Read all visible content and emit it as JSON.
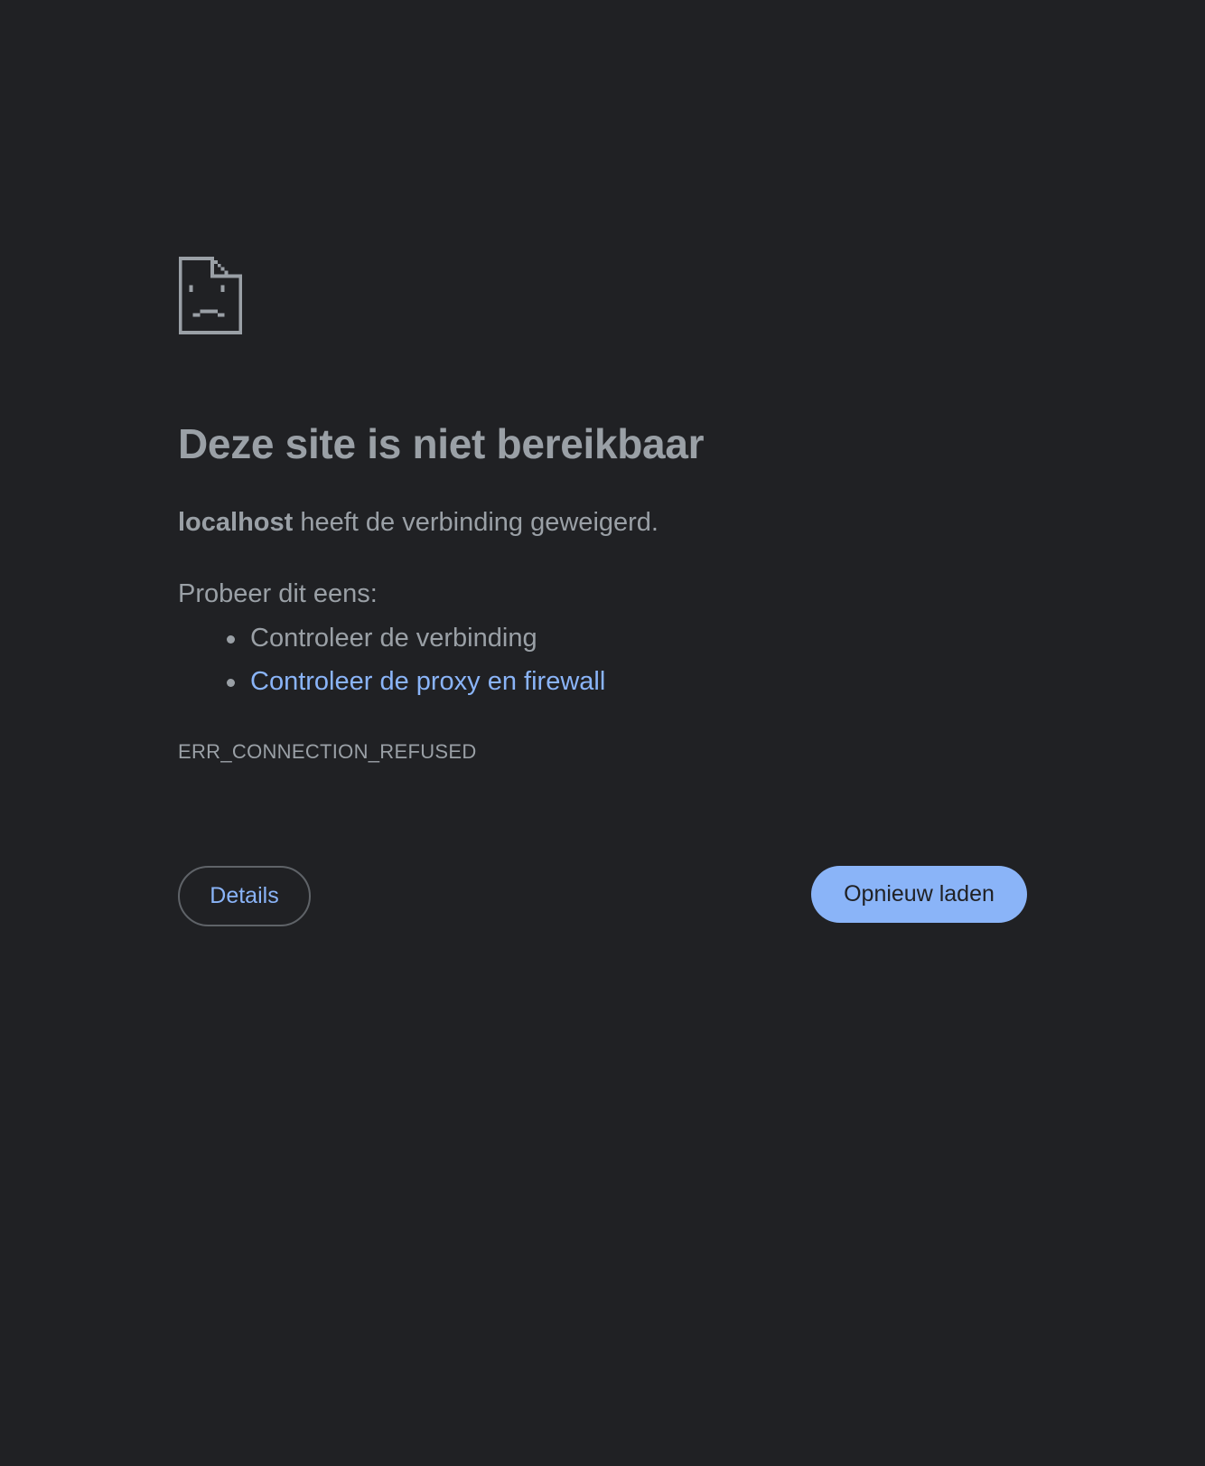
{
  "icon": {
    "name": "sad-document-icon",
    "color": "#9aa0a6"
  },
  "heading": "Deze site is niet bereikbaar",
  "summary": {
    "host": "localhost",
    "message": " heeft de verbinding geweigerd."
  },
  "suggestions": {
    "heading": "Probeer dit eens:",
    "items": [
      {
        "label": "Controleer de verbinding"
      },
      {
        "label": "Controleer de proxy en firewall"
      }
    ]
  },
  "error_code": "ERR_CONNECTION_REFUSED",
  "buttons": {
    "details": "Details",
    "reload": "Opnieuw laden"
  },
  "colors": {
    "background": "#202124",
    "text": "#9aa0a6",
    "link": "#8ab4f8",
    "primary_button": "#8ab4f8",
    "outline": "#5f6368"
  }
}
